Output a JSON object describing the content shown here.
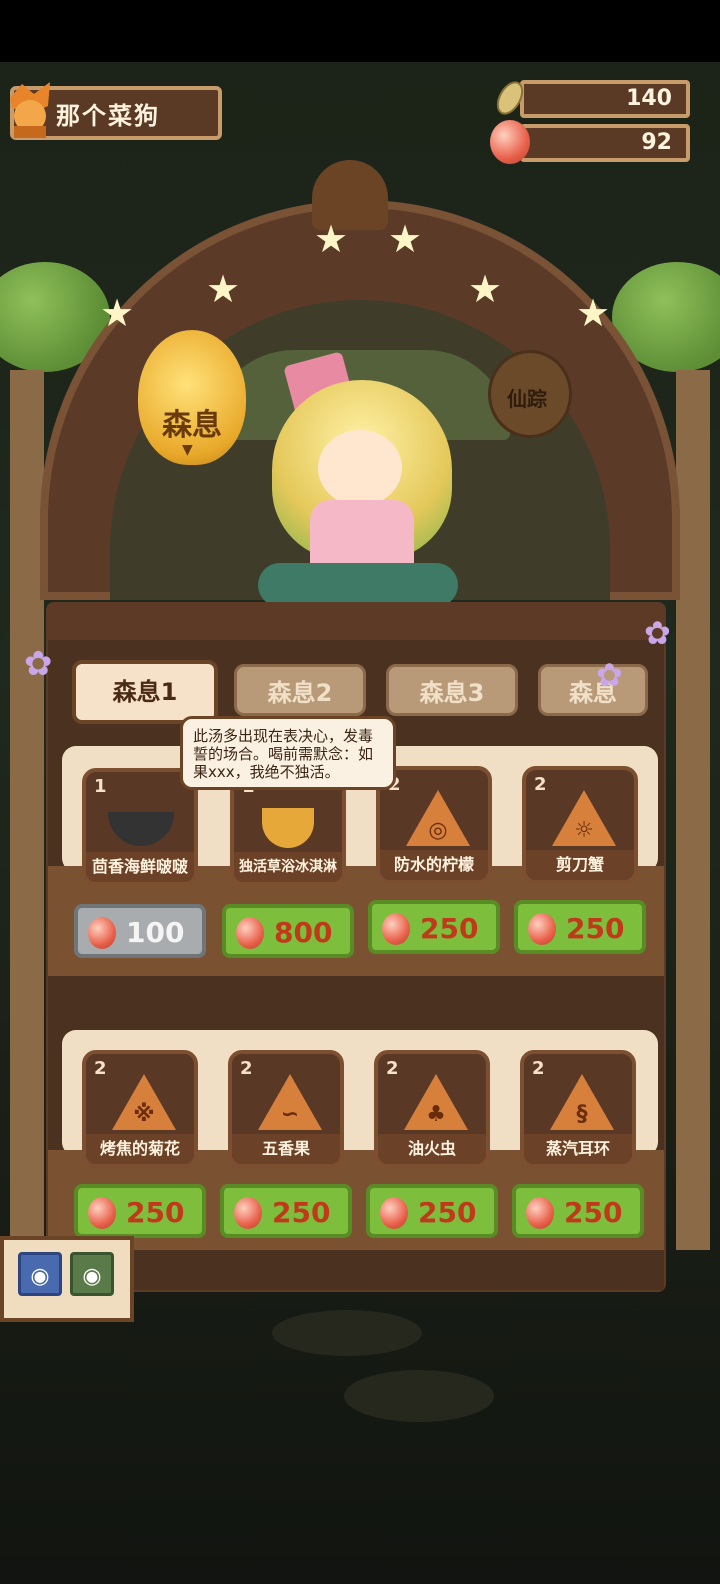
{
  "player": {
    "name": "那个菜狗"
  },
  "resources": {
    "leaves": "140",
    "gems": "92"
  },
  "bells": {
    "active": "森息",
    "locked": "仙踪"
  },
  "tabs": [
    {
      "label": "森息1"
    },
    {
      "label": "森息2"
    },
    {
      "label": "森息3"
    },
    {
      "label": "森息"
    }
  ],
  "tooltip": {
    "text": "此汤多出现在表决心，发毒誓的场合。喝前需默念：如果xxx，我绝不独活。"
  },
  "shelf1": {
    "items": [
      {
        "count": "1",
        "label": "茴香海鲜啵啵",
        "price": "100",
        "affordable": false
      },
      {
        "count": "1",
        "label": "独活草浴冰淇淋",
        "price": "800",
        "affordable": true
      },
      {
        "count": "2",
        "label": "防水的柠檬",
        "price": "250",
        "affordable": true,
        "symbol": "◎"
      },
      {
        "count": "2",
        "label": "剪刀蟹",
        "price": "250",
        "affordable": true,
        "symbol": "☼"
      }
    ]
  },
  "shelf2": {
    "items": [
      {
        "count": "2",
        "label": "烤焦的菊花",
        "price": "250",
        "symbol": "※"
      },
      {
        "count": "2",
        "label": "五香果",
        "price": "250",
        "symbol": "∽"
      },
      {
        "count": "2",
        "label": "油火虫",
        "price": "250",
        "symbol": "♣"
      },
      {
        "count": "2",
        "label": "蒸汽耳环",
        "price": "250",
        "symbol": "§"
      }
    ]
  },
  "colors": {
    "accent_green": "#7dbf3c",
    "wood": "#5d3a25",
    "price_red": "#c0391b"
  }
}
